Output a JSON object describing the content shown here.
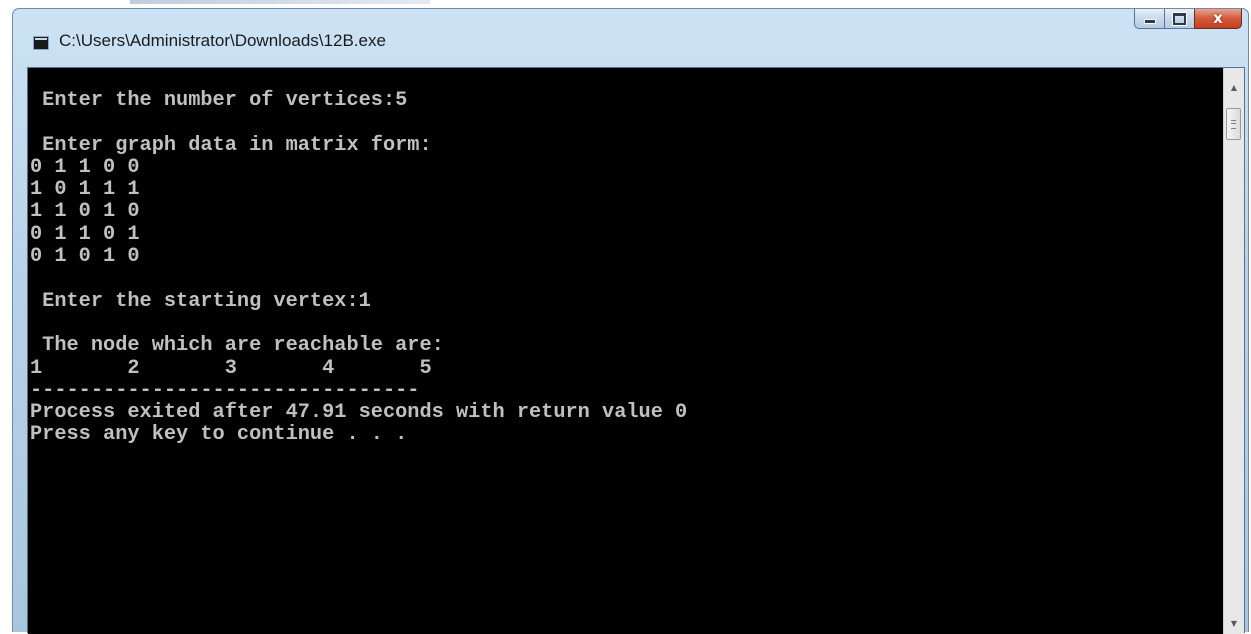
{
  "window": {
    "title": "C:\\Users\\Administrator\\Downloads\\12B.exe",
    "icon": "console-app-icon",
    "controls": {
      "minimize_icon": "minimize-icon",
      "maximize_icon": "maximize-icon",
      "close_icon": "close-icon",
      "close_glyph": "x"
    }
  },
  "console": {
    "lines": [
      " Enter the number of vertices:5",
      "",
      " Enter graph data in matrix form:",
      "0 1 1 0 0",
      "1 0 1 1 1",
      "1 1 0 1 0",
      "0 1 1 0 1",
      "0 1 0 1 0",
      "",
      " Enter the starting vertex:1",
      "",
      " The node which are reachable are:",
      "1\t2\t3\t4\t5",
      "--------------------------------",
      "Process exited after 47.91 seconds with return value 0",
      "Press any key to continue . . ."
    ]
  },
  "scrollbar": {
    "up_glyph": "▲",
    "down_glyph": "▼"
  },
  "colors": {
    "console_background": "#000000",
    "console_text": "#c0c0c0",
    "close_button": "#c43f1f"
  }
}
